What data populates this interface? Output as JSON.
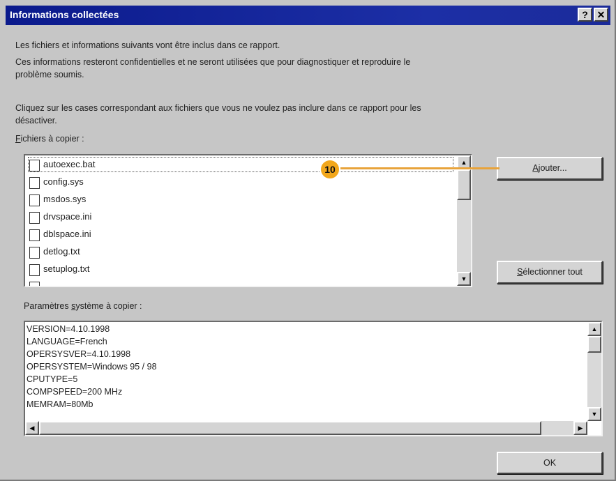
{
  "window": {
    "title": "Informations collectées",
    "help_glyph": "?",
    "close_glyph": "✕"
  },
  "intro": {
    "line1": "Les fichiers et informations suivants vont être inclus dans ce rapport.",
    "line2a": "Ces informations resteront confidentielles et ne seront utilisées que pour diagnostiquer et reproduire le",
    "line2b": "problème soumis.",
    "line3a": "Cliquez sur les cases correspondant aux fichiers que vous ne voulez pas inclure dans ce rapport pour les",
    "line3b": "désactiver."
  },
  "files": {
    "label_mnemonic": "F",
    "label_rest": "ichiers à copier :",
    "items": [
      {
        "name": "autoexec.bat",
        "checked": false
      },
      {
        "name": "config.sys",
        "checked": false
      },
      {
        "name": "msdos.sys",
        "checked": false
      },
      {
        "name": "drvspace.ini",
        "checked": false
      },
      {
        "name": "dblspace.ini",
        "checked": false
      },
      {
        "name": "detlog.txt",
        "checked": false
      },
      {
        "name": "setuplog.txt",
        "checked": false
      }
    ]
  },
  "buttons": {
    "add_mnemonic": "A",
    "add_rest": "jouter...",
    "select_all_mnemonic": "S",
    "select_all_rest": "électionner tout",
    "ok": "OK"
  },
  "system": {
    "label_before": "Paramètres ",
    "label_mnemonic": "s",
    "label_after": "ystème à copier :",
    "lines": [
      "VERSION=4.10.1998",
      "LANGUAGE=French",
      "OPERSYSVER=4.10.1998",
      "OPERSYSTEM=Windows 95 / 98",
      "CPUTYPE=5",
      "COMPSPEED=200 MHz",
      "MEMRAM=80Mb"
    ]
  },
  "callout": {
    "number": "10",
    "color": "#f2a71b"
  },
  "scroll_glyphs": {
    "up": "▲",
    "down": "▼",
    "left": "◀",
    "right": "▶"
  }
}
